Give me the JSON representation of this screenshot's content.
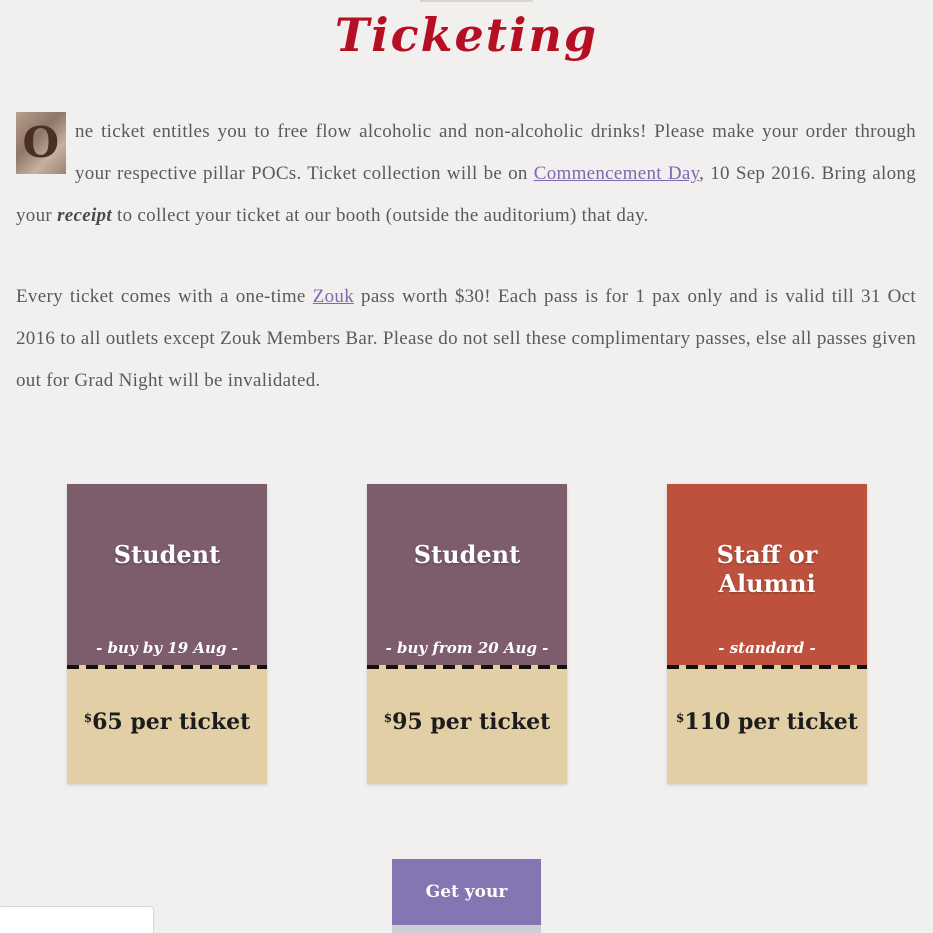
{
  "page": {
    "title": "Ticketing"
  },
  "intro": {
    "dropcap": "O",
    "line1": "ne ticket entitles you to free flow alcoholic and non-alcoholic drinks! Please make your order through your respective pillar POCs. Ticket collection will be on ",
    "link_commencement": "Commencement Day",
    "line2": ", 10 Sep 2016. Bring along your ",
    "receipt": "receipt",
    "line3": " to collect your ticket at our booth (outside the auditorium) that day."
  },
  "para2": {
    "part1": "Every ticket comes with a one-time ",
    "link_zouk": "Zouk",
    "part2": " pass worth $30! Each pass is for 1 pax only and is valid till 31 Oct 2016 to all outlets except Zouk Members Bar. Please do not sell these complimentary passes, else all passes given out for Grad Night will be invalidated."
  },
  "tickets": [
    {
      "name": "Student",
      "subtitle": "- buy by 19 Aug -",
      "currency": "$",
      "price": "65 per ticket",
      "color": "#7d5c6b"
    },
    {
      "name": "Student",
      "subtitle": "- buy from 20 Aug -",
      "currency": "$",
      "price": "95 per ticket",
      "color": "#7d5c6b"
    },
    {
      "name": "Staff or Alumni",
      "subtitle": "- standard -",
      "currency": "$",
      "price": "110 per ticket",
      "color": "#bd513d"
    }
  ],
  "cta": {
    "label": "Get your tickets",
    "color": "#8376b3"
  },
  "colors": {
    "title": "#b50f23",
    "link": "#7f68b0",
    "ticket_stub": "#e2cfa6"
  }
}
